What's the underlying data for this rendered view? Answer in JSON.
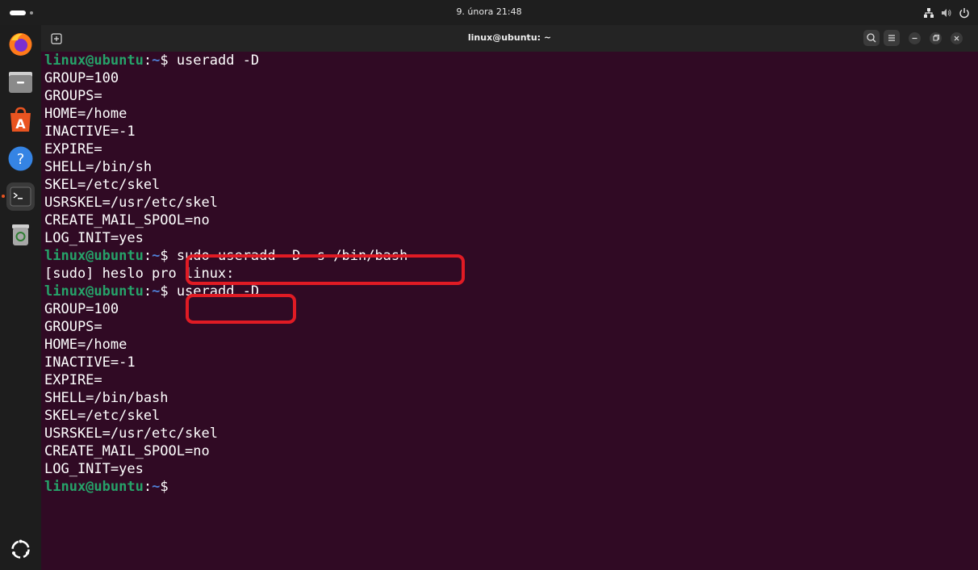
{
  "topbar": {
    "clock": "9. února 21:48"
  },
  "window": {
    "title": "linux@ubuntu: ~"
  },
  "dock": {
    "items": [
      "firefox-icon",
      "files-icon",
      "app-center-icon",
      "help-icon",
      "terminal-icon",
      "trash-icon",
      "show-apps-icon"
    ]
  },
  "prompt": {
    "user": "linux@ubuntu",
    "colon": ":",
    "path": "~",
    "symbol": "$ "
  },
  "terminal": {
    "lines": [
      {
        "kind": "prompt",
        "cmd": "useradd -D"
      },
      {
        "kind": "out",
        "text": "GROUP=100"
      },
      {
        "kind": "out",
        "text": "GROUPS="
      },
      {
        "kind": "out",
        "text": "HOME=/home"
      },
      {
        "kind": "out",
        "text": "INACTIVE=-1"
      },
      {
        "kind": "out",
        "text": "EXPIRE="
      },
      {
        "kind": "out",
        "text": "SHELL=/bin/sh"
      },
      {
        "kind": "out",
        "text": "SKEL=/etc/skel"
      },
      {
        "kind": "out",
        "text": "USRSKEL=/usr/etc/skel"
      },
      {
        "kind": "out",
        "text": "CREATE_MAIL_SPOOL=no"
      },
      {
        "kind": "out",
        "text": "LOG_INIT=yes"
      },
      {
        "kind": "prompt",
        "cmd": "sudo useradd -D -s /bin/bash"
      },
      {
        "kind": "out",
        "text": "[sudo] heslo pro linux:"
      },
      {
        "kind": "prompt",
        "cmd": "useradd -D"
      },
      {
        "kind": "out",
        "text": "GROUP=100"
      },
      {
        "kind": "out",
        "text": "GROUPS="
      },
      {
        "kind": "out",
        "text": "HOME=/home"
      },
      {
        "kind": "out",
        "text": "INACTIVE=-1"
      },
      {
        "kind": "out",
        "text": "EXPIRE="
      },
      {
        "kind": "out",
        "text": "SHELL=/bin/bash"
      },
      {
        "kind": "out",
        "text": "SKEL=/etc/skel"
      },
      {
        "kind": "out",
        "text": "USRSKEL=/usr/etc/skel"
      },
      {
        "kind": "out",
        "text": "CREATE_MAIL_SPOOL=no"
      },
      {
        "kind": "out",
        "text": "LOG_INIT=yes"
      },
      {
        "kind": "prompt",
        "cmd": ""
      }
    ]
  },
  "annotations": {
    "color": "#e01b24"
  }
}
